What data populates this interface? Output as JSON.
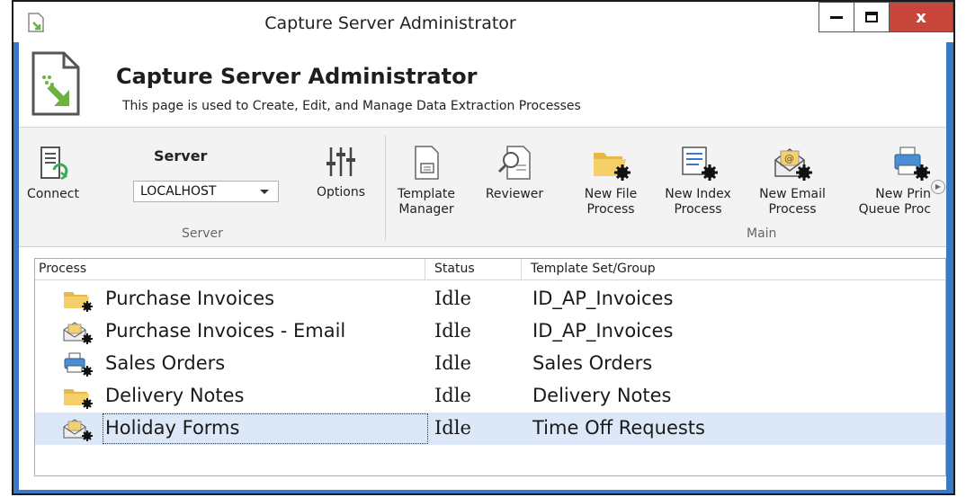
{
  "window": {
    "title": "Capture Server Administrator",
    "close_glyph": "x"
  },
  "header": {
    "title": "Capture Server Administrator",
    "subtitle": "This page is used to Create, Edit, and Manage Data Extraction Processes"
  },
  "ribbon": {
    "connect_label": "Connect",
    "server_label": "Server",
    "server_value": "LOCALHOST",
    "options_label": "Options",
    "server_group": "Server",
    "main_group": "Main",
    "buttons": [
      {
        "line1": "Template",
        "line2": "Manager",
        "icon": "template-icon"
      },
      {
        "line1": "Reviewer",
        "line2": "",
        "icon": "reviewer-icon"
      },
      {
        "line1": "New File",
        "line2": "Process",
        "icon": "folder-gear-icon"
      },
      {
        "line1": "New Index",
        "line2": "Process",
        "icon": "index-gear-icon"
      },
      {
        "line1": "New Email",
        "line2": "Process",
        "icon": "email-gear-icon"
      },
      {
        "line1": "New Prin",
        "line2": "Queue Proc",
        "icon": "printer-gear-icon"
      }
    ]
  },
  "grid": {
    "columns": [
      "Process",
      "Status",
      "Template Set/Group"
    ],
    "rows": [
      {
        "process": "Purchase Invoices",
        "status": "Idle",
        "template": "ID_AP_Invoices",
        "icon": "folder-gear-icon"
      },
      {
        "process": "Purchase Invoices - Email",
        "status": "Idle",
        "template": "ID_AP_Invoices",
        "icon": "email-gear-icon"
      },
      {
        "process": "Sales Orders",
        "status": "Idle",
        "template": "Sales Orders",
        "icon": "printer-gear-icon"
      },
      {
        "process": "Delivery Notes",
        "status": "Idle",
        "template": "Delivery Notes",
        "icon": "folder-gear-icon"
      },
      {
        "process": "Holiday Forms",
        "status": "Idle",
        "template": "Time Off Requests",
        "icon": "email-gear-icon",
        "selected": true
      }
    ]
  },
  "colors": {
    "accent": "#3b79c7",
    "close": "#c9463d",
    "selection": "#dce7f8",
    "icon_green": "#6bb33d"
  }
}
